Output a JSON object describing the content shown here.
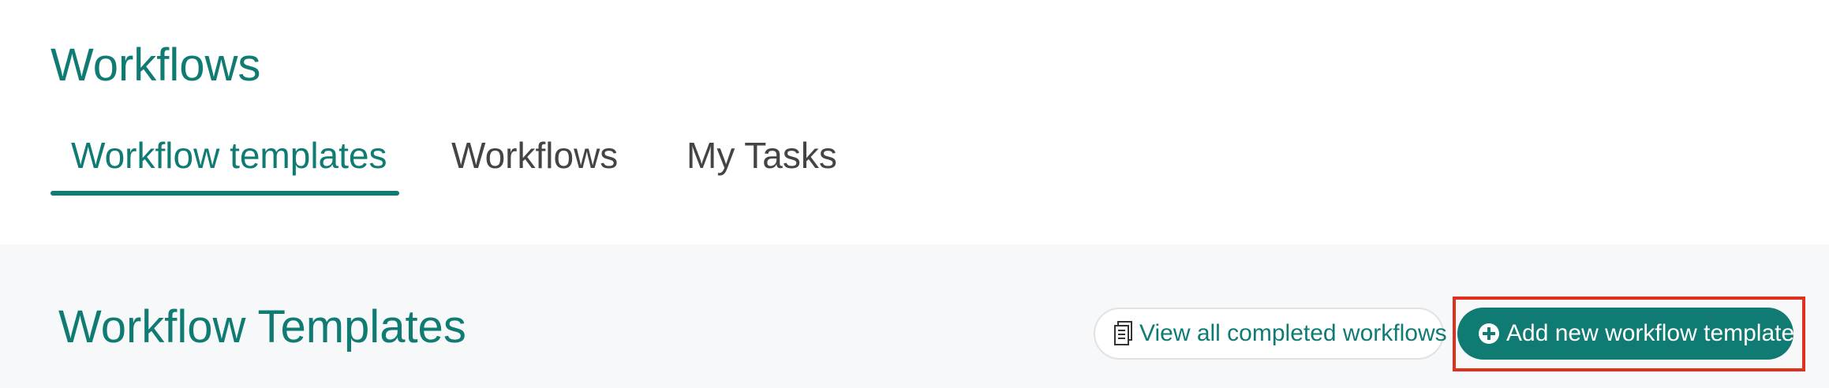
{
  "header": {
    "title": "Workflows",
    "tabs": [
      {
        "label": "Workflow templates",
        "active": true
      },
      {
        "label": "Workflows",
        "active": false
      },
      {
        "label": "My Tasks",
        "active": false
      }
    ]
  },
  "section": {
    "title": "Workflow Templates",
    "view_completed_label": "View all completed workflows",
    "view_completed_icon": "document-icon",
    "add_template_label": "Add new workflow template",
    "add_template_icon": "plus-circle-icon"
  },
  "colors": {
    "accent": "#0f7b73",
    "tab_inactive": "#444444",
    "section_background": "#f6f8fa",
    "highlight_border": "#e0301e"
  }
}
